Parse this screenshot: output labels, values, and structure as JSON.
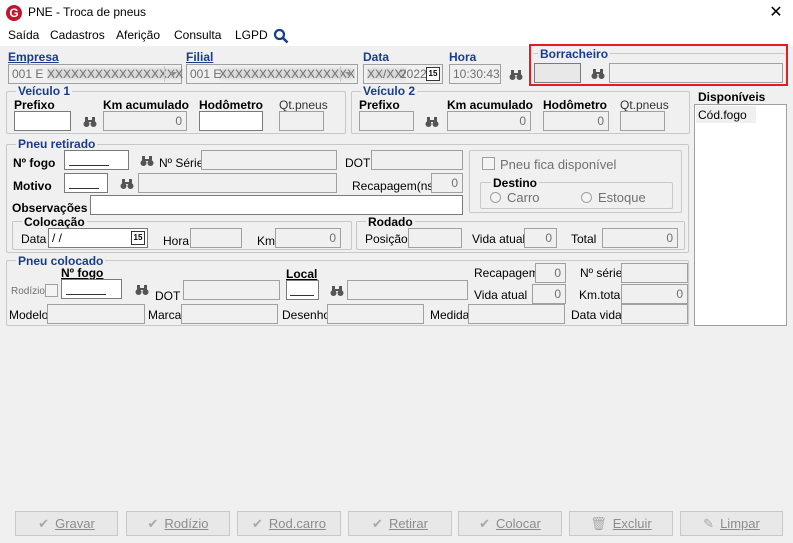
{
  "window": {
    "title": "PNE - Troca de pneus",
    "close_glyph": "✕"
  },
  "menu": {
    "items": [
      "Saída",
      "Cadastros",
      "Aferição",
      "Consulta",
      "LGPD"
    ]
  },
  "header": {
    "empresa_label": "Empresa",
    "empresa_value": "001 E",
    "filial_label": "Filial",
    "filial_value": "001 E",
    "data_label": "Data",
    "data_value": "2022",
    "hora_label": "Hora",
    "hora_value": "10:30:43",
    "borracheiro_label": "Borracheiro"
  },
  "veiculo1": {
    "title": "Veículo 1",
    "prefixo": "Prefixo",
    "km": "Km acumulado",
    "km_value": "0",
    "hodometro": "Hodômetro",
    "qt": "Qt.pneus"
  },
  "veiculo2": {
    "title": "Veículo 2",
    "prefixo": "Prefixo",
    "km": "Km acumulado",
    "km_value": "0",
    "hodometro": "Hodômetro",
    "hod_value": "0",
    "qt": "Qt.pneus"
  },
  "disponiveis": {
    "title": "Disponíveis",
    "col": "Cód.fogo"
  },
  "pneu_retirado": {
    "title": "Pneu retirado",
    "nfogo": "Nº fogo",
    "nserie": "Nº Série",
    "dot": "DOT",
    "motivo": "Motivo",
    "recapagem": "Recapagem(ns)",
    "recapagem_value": "0",
    "observacoes": "Observações",
    "fica_disponivel": "Pneu fica disponível",
    "destino": "Destino",
    "carro": "Carro",
    "estoque": "Estoque"
  },
  "colocacao": {
    "title": "Colocação",
    "data": "Data",
    "data_value": " / /",
    "hora": "Hora",
    "km": "Km",
    "km_value": "0"
  },
  "rodado": {
    "title": "Rodado",
    "posicao": "Posição",
    "vida_atual": "Vida atual",
    "vida_value": "0",
    "total": "Total",
    "total_value": "0"
  },
  "pneu_colocado": {
    "title": "Pneu colocado",
    "nfogo": "Nº fogo",
    "local": "Local",
    "recapagem": "Recapagem",
    "recapagem_value": "0",
    "nserie": "Nº série",
    "rodizio": "Rodízio",
    "dot": "DOT",
    "vida_atual": "Vida atual",
    "vida_value": "0",
    "km_total": "Km.total",
    "km_total_value": "0",
    "modelo": "Modelo",
    "marca": "Marca",
    "desenho": "Desenho",
    "medida": "Medida",
    "data_vida": "Data vida"
  },
  "buttons": {
    "gravar": "Gravar",
    "rodizio": "Rodízio",
    "rod_carro": "Rod.carro",
    "retirar": "Retirar",
    "colocar": "Colocar",
    "excluir": "Excluir",
    "limpar": "Limpar"
  },
  "colors": {
    "label_blue": "#1a3c8c",
    "highlight_red": "#e02020",
    "app_icon": "#c0152f"
  }
}
